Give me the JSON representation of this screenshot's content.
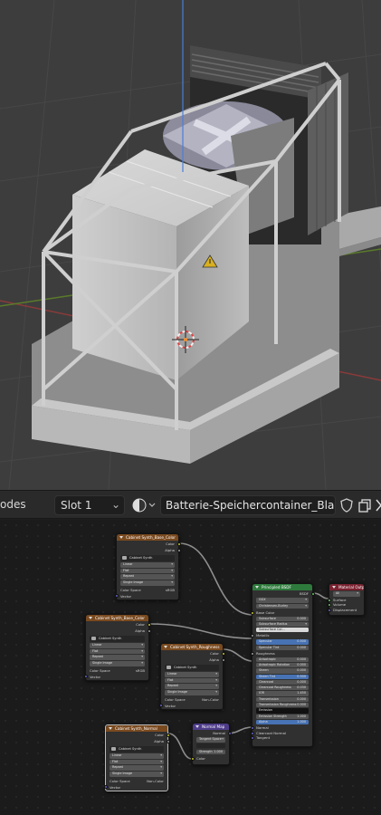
{
  "header": {
    "mode_label": "odes",
    "slot_label": "Slot 1",
    "material_name": "Batterie-Speichercontainer_Blau"
  },
  "nodes": {
    "tex1": {
      "title": "Cabinet Synth_Base_Color",
      "outputs": [
        "Color",
        "Alpha"
      ],
      "image": "Cabinet Synth",
      "props": [
        "Linear",
        "Flat",
        "Repeat",
        "Single Image"
      ],
      "colorspace_label": "Color Space",
      "colorspace_value": "sRGB",
      "vector": "Vector"
    },
    "tex2": {
      "title": "Cabinet Synth_Base_Color",
      "outputs": [
        "Color",
        "Alpha"
      ],
      "image": "Cabinet Synth",
      "props": [
        "Linear",
        "Flat",
        "Repeat",
        "Single Image"
      ],
      "colorspace_label": "Color Space",
      "colorspace_value": "sRGB",
      "vector": "Vector"
    },
    "tex3": {
      "title": "Cabinet Synth_Roughness",
      "outputs": [
        "Color",
        "Alpha"
      ],
      "image": "Cabinet Synth",
      "props": [
        "Linear",
        "Flat",
        "Repeat",
        "Single Image"
      ],
      "colorspace_label": "Color Space",
      "colorspace_value": "Non-Color",
      "vector": "Vector"
    },
    "tex4": {
      "title": "Cabinet Synth_Normal",
      "outputs": [
        "Color",
        "Alpha"
      ],
      "image": "Cabinet Synth",
      "props": [
        "Linear",
        "Flat",
        "Repeat",
        "Single Image"
      ],
      "colorspace_label": "Color Space",
      "colorspace_value": "Non-Color",
      "vector": "Vector"
    },
    "normal": {
      "title": "Normal Map",
      "output": "Normal",
      "space": "Tangent Space",
      "uv": "",
      "strength_label": "Strength",
      "strength_value": "1.000",
      "color_in": "Color"
    },
    "bsdf": {
      "title": "Principled BSDF",
      "output": "BSDF",
      "distribution": "GGX",
      "subsurface_method": "Christensen-Burley",
      "base_color": "Base Color",
      "rows": [
        {
          "label": "Subsurface",
          "value": "0.000",
          "style": "grey"
        },
        {
          "label": "Subsurface Radius",
          "value": "",
          "style": "drop"
        },
        {
          "label": "Subsurface Col...",
          "value": "",
          "style": "white"
        },
        {
          "label": "Metallic",
          "value": "",
          "style": "socket"
        },
        {
          "label": "Specular",
          "value": "0.500",
          "style": "blue"
        },
        {
          "label": "Specular Tint",
          "value": "0.000",
          "style": "grey"
        },
        {
          "label": "Roughness",
          "value": "",
          "style": "socket"
        },
        {
          "label": "Anisotropic",
          "value": "0.000",
          "style": "grey"
        },
        {
          "label": "Anisotropic Rotation",
          "value": "0.000",
          "style": "grey"
        },
        {
          "label": "Sheen",
          "value": "0.000",
          "style": "grey"
        },
        {
          "label": "Sheen Tint",
          "value": "0.500",
          "style": "blue"
        },
        {
          "label": "Clearcoat",
          "value": "0.000",
          "style": "grey"
        },
        {
          "label": "Clearcoat Roughness",
          "value": "0.030",
          "style": "grey"
        },
        {
          "label": "IOR",
          "value": "1.450",
          "style": "grey"
        },
        {
          "label": "Transmission",
          "value": "0.000",
          "style": "grey"
        },
        {
          "label": "Transmission Roughness",
          "value": "0.000",
          "style": "grey"
        },
        {
          "label": "Emission",
          "value": "",
          "style": "black"
        },
        {
          "label": "Emission Strength",
          "value": "1.000",
          "style": "grey"
        },
        {
          "label": "Alpha",
          "value": "1.000",
          "style": "blue"
        }
      ],
      "tail": [
        "Normal",
        "Clearcoat Normal",
        "Tangent"
      ]
    },
    "output": {
      "title": "Material Output",
      "target": "All",
      "inputs": [
        "Surface",
        "Volume",
        "Displacement"
      ]
    }
  },
  "colors": {
    "image_header": "#7a4a1f",
    "shader_header": "#2e7a3c",
    "output_header": "#7a2230",
    "vector_header": "#4e3c8a",
    "link": "#9a9a9a"
  }
}
